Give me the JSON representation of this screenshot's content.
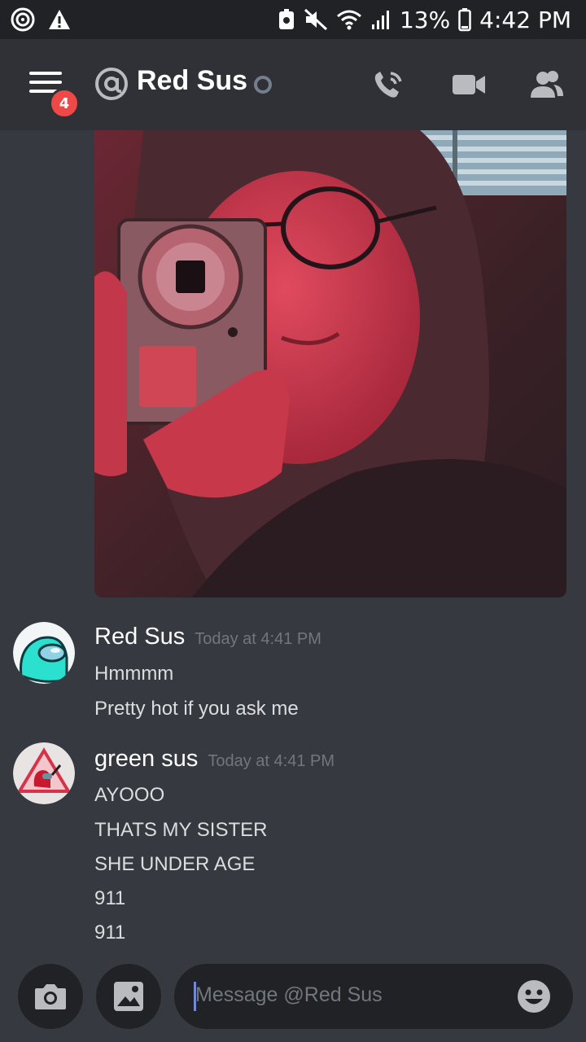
{
  "status_bar": {
    "battery_percent": "13%",
    "time": "4:42 PM"
  },
  "header": {
    "unread_badge": "4",
    "title": "Red Sus",
    "presence": "offline",
    "actions": [
      "voice-call-icon",
      "video-call-icon",
      "members-icon"
    ]
  },
  "messages": [
    {
      "author": "Red Sus",
      "timestamp": "Today at 4:41 PM",
      "lines": [
        "Hmmmm",
        "Pretty hot if you ask me"
      ]
    },
    {
      "author": "green sus",
      "timestamp": "Today at 4:41 PM",
      "lines": [
        "AYOOO",
        "THATS MY SISTER",
        "SHE UNDER AGE",
        "911",
        "911"
      ]
    }
  ],
  "composer": {
    "placeholder": "Message @Red Sus"
  },
  "colors": {
    "background": "#36393f",
    "header": "#2f3136",
    "status_bar": "#202225",
    "badge": "#f04747",
    "accent": "#7289da",
    "timestamp": "#72767d"
  }
}
